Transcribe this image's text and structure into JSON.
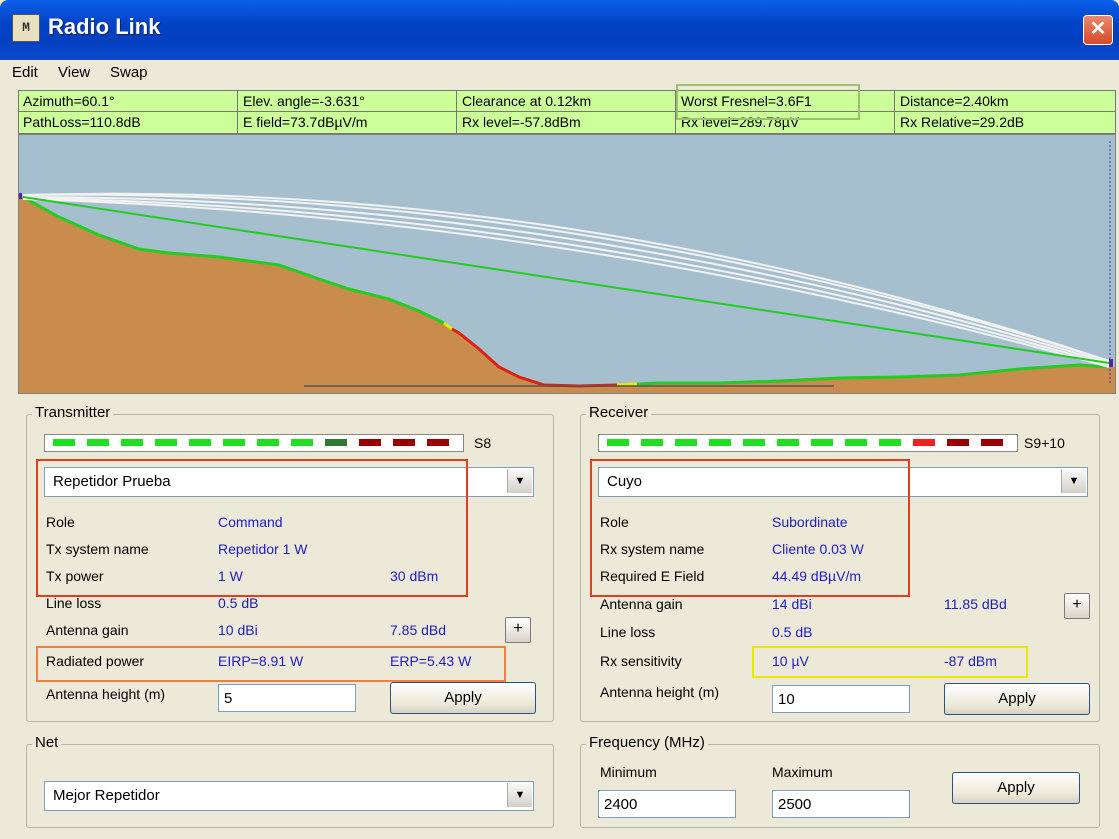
{
  "window": {
    "title": "Radio Link",
    "icon_text": "M",
    "close_glyph": "✕"
  },
  "menu": [
    "Edit",
    "View",
    "Swap"
  ],
  "info": {
    "row1": [
      "Azimuth=60.1°",
      "Elev. angle=-3.631°",
      "Clearance at 0.12km",
      "Worst Fresnel=3.6F1",
      "Distance=2.40km"
    ],
    "row2": [
      "PathLoss=110.8dB",
      "E field=73.7dBµV/m",
      "Rx level=-57.8dBm",
      "Rx level=289.78µV",
      "Rx Relative=29.2dB"
    ]
  },
  "transmitter": {
    "title": "Transmitter",
    "signal": "S8",
    "signal_level_segments": 8,
    "station": "Repetidor Prueba",
    "role_label": "Role",
    "role_value": "Command",
    "system_label": "Tx system name",
    "system_value": "Repetidor 1 W",
    "power_label": "Tx power",
    "power_w": "1 W",
    "power_dbm": "30 dBm",
    "line_loss_label": "Line loss",
    "line_loss_value": "0.5 dB",
    "gain_label": "Antenna gain",
    "gain_dbi": "10 dBi",
    "gain_dbd": "7.85 dBd",
    "radiated_label": "Radiated power",
    "eirp": "EIRP=8.91 W",
    "erp": "ERP=5.43 W",
    "height_label": "Antenna height (m)",
    "height_value": "5",
    "apply": "Apply",
    "plus": "+"
  },
  "receiver": {
    "title": "Receiver",
    "signal": "S9+10",
    "signal_level_segments": 10,
    "station": "Cuyo",
    "role_label": "Role",
    "role_value": "Subordinate",
    "system_label": "Rx system name",
    "system_value": "Cliente 0.03 W",
    "field_label": "Required E Field",
    "field_value": "44.49 dBµV/m",
    "gain_label": "Antenna gain",
    "gain_dbi": "14 dBi",
    "gain_dbd": "11.85 dBd",
    "line_loss_label": "Line loss",
    "line_loss_value": "0.5 dB",
    "sens_label": "Rx sensitivity",
    "sens_uv": "10 µV",
    "sens_dbm": "-87 dBm",
    "height_label": "Antenna height (m)",
    "height_value": "10",
    "apply": "Apply",
    "plus": "+"
  },
  "net": {
    "title": "Net",
    "value": "Mejor Repetidor"
  },
  "frequency": {
    "title": "Frequency (MHz)",
    "min_label": "Minimum",
    "max_label": "Maximum",
    "min_value": "2400",
    "max_value": "2500",
    "apply": "Apply"
  },
  "colors": {
    "info_bg": "#ccff99",
    "sky": "#a6bfce",
    "terrain": "#c98c4c",
    "los": "#22cc22",
    "highlight_red": "#e04020",
    "highlight_orange": "#f08040",
    "highlight_yellow": "#e8e800"
  }
}
